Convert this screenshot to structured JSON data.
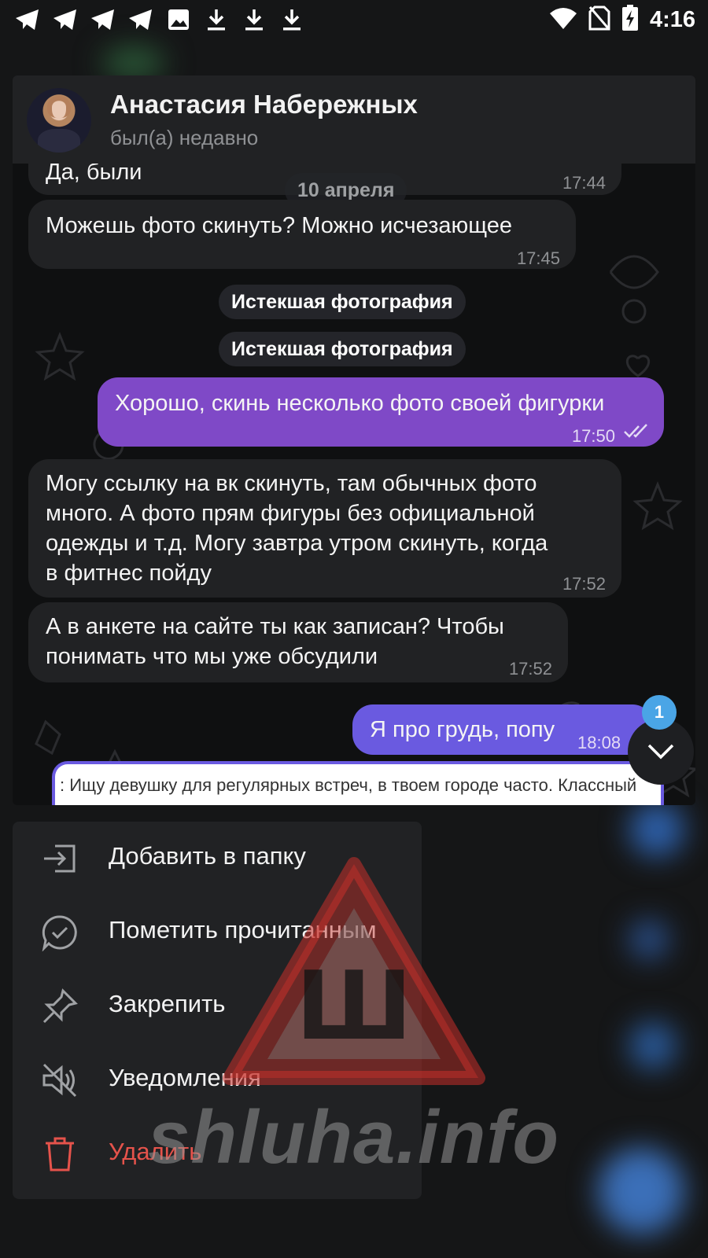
{
  "status_bar": {
    "left_icons": [
      "telegram-icon",
      "telegram-icon",
      "telegram-icon",
      "telegram-icon",
      "image-icon",
      "download-icon",
      "download-icon",
      "download-icon"
    ],
    "right_icons": [
      "wifi-icon",
      "no-sim-icon",
      "battery-charging-icon"
    ],
    "time": "4:16"
  },
  "chat": {
    "contact_name": "Анастасия Набережных",
    "contact_status": "был(а) недавно",
    "date_pill": "10 апреля",
    "messages": [
      {
        "dir": "in",
        "lines": [
          "Да, были"
        ],
        "time": "17:44"
      },
      {
        "dir": "in",
        "lines": [
          "Можешь фото скинуть? Можно исчезающее"
        ],
        "time": "17:45"
      },
      {
        "dir": "service",
        "text": "Истекшая фотография"
      },
      {
        "dir": "service",
        "text": "Истекшая фотография"
      },
      {
        "dir": "out",
        "lines": [
          "Хорошо, скинь несколько фото своей фигурки"
        ],
        "time": "17:50"
      },
      {
        "dir": "in",
        "lines": [
          "Могу ссылку на вк скинуть, там обычных фото",
          "много. А фото прям фигуры без официальной",
          "одежды и т.д. Могу завтра утром скинуть, когда",
          "в фитнес пойду"
        ],
        "time": "17:52"
      },
      {
        "dir": "in",
        "lines": [
          "А в анкете на сайте ты как записан? Чтобы",
          "понимать что мы уже обсудили"
        ],
        "time": "17:52"
      },
      {
        "dir": "out",
        "lines": [
          "Я про грудь, попу"
        ],
        "time": "18:08"
      }
    ],
    "quoted_snippet": ": Ищу девушку для регулярных встреч, в твоем городе часто. Классный",
    "unread_count": "1"
  },
  "menu": {
    "items": [
      {
        "label": "Добавить в папку",
        "icon": "folder-add-icon"
      },
      {
        "label": "Пометить прочитанным",
        "icon": "chat-check-icon"
      },
      {
        "label": "Закрепить",
        "icon": "pin-icon"
      },
      {
        "label": "Уведомления",
        "icon": "mute-icon"
      },
      {
        "label": "Удалить",
        "icon": "trash-icon"
      }
    ]
  },
  "watermark": {
    "text": "shluha.info",
    "symbol": "Ш"
  },
  "colors": {
    "background": "#151617",
    "incoming_bubble": "#212224",
    "outgoing_bubble": "#7f49c7",
    "outgoing_bubble_latest": "#6a5ae0",
    "badge": "#4aa5e6",
    "danger": "#e5534b",
    "watermark_red": "#c0302a"
  }
}
